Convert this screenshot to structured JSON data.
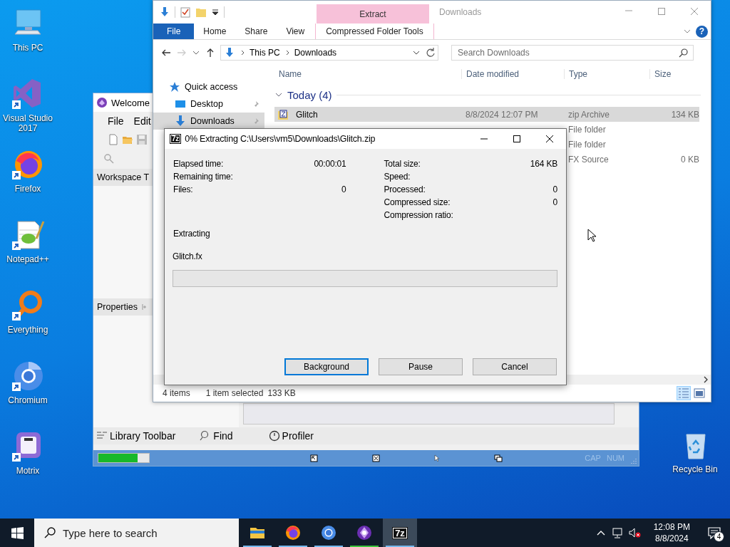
{
  "desktop": {
    "icons": [
      {
        "label": "This PC",
        "kind": "computer",
        "shortcut": false
      },
      {
        "label": "Visual Studio 2017",
        "kind": "visual-studio",
        "shortcut": true
      },
      {
        "label": "Firefox",
        "kind": "firefox",
        "shortcut": true
      },
      {
        "label": "Notepad++",
        "kind": "notepad",
        "shortcut": true
      },
      {
        "label": "Everything",
        "kind": "everything",
        "shortcut": true
      },
      {
        "label": "Chromium",
        "kind": "chromium",
        "shortcut": true
      },
      {
        "label": "Motrix",
        "kind": "motrix",
        "shortcut": true
      }
    ],
    "recycle_bin": {
      "label": "Recycle Bin"
    }
  },
  "background_window": {
    "title": "Welcome",
    "menu": [
      "File",
      "Edit"
    ],
    "workspace_panel": "Workspace T",
    "properties_panel": "Properties",
    "bottom_tabs": [
      {
        "label": "Library Toolbar",
        "kind": "library"
      },
      {
        "label": "Find",
        "kind": "find"
      },
      {
        "label": "Profiler",
        "kind": "profiler"
      }
    ],
    "status_bar": {
      "level": 0.77,
      "indicators": [
        {
          "label": "CAP",
          "on": false
        },
        {
          "label": "NUM",
          "on": false
        }
      ]
    }
  },
  "explorer": {
    "title": "Downloads",
    "context_tab": "Extract",
    "ribbon_tabs": [
      {
        "label": "File",
        "kind": "file"
      },
      {
        "label": "Home",
        "kind": "tab"
      },
      {
        "label": "Share",
        "kind": "tab"
      },
      {
        "label": "View",
        "kind": "tab"
      },
      {
        "label": "Compressed Folder Tools",
        "kind": "context"
      }
    ],
    "help": "?",
    "path": [
      "This PC",
      "Downloads"
    ],
    "search_placeholder": "Search Downloads",
    "nav": [
      {
        "label": "Quick access",
        "kind": "star",
        "pinned": false,
        "selected": false
      },
      {
        "label": "Desktop",
        "kind": "desktop",
        "pinned": true,
        "selected": false
      },
      {
        "label": "Downloads",
        "kind": "download",
        "pinned": true,
        "selected": true
      }
    ],
    "columns": [
      "Name",
      "Date modified",
      "Type",
      "Size"
    ],
    "group": "Today (4)",
    "rows": [
      {
        "name": "Glitch",
        "kind": "zip",
        "date": "8/8/2024 12:07 PM",
        "type": "zip Archive",
        "size": "134 KB",
        "selected": true
      },
      {
        "type": "File folder",
        "selected": false
      },
      {
        "type": "File folder",
        "selected": false
      },
      {
        "type": "FX Source",
        "size": "0 KB",
        "selected": false
      }
    ],
    "status": {
      "count": "4 items",
      "selection": "1 item selected",
      "selection_size": "133 KB"
    }
  },
  "dialog": {
    "badge": "7z",
    "title": "0% Extracting C:\\Users\\vm5\\Downloads\\Glitch.zip",
    "left_stats": [
      {
        "label": "Elapsed time:",
        "value": "00:00:01"
      },
      {
        "label": "Remaining time:"
      },
      {
        "label": "Files:",
        "value": "0"
      }
    ],
    "right_stats": [
      {
        "label": "Total size:",
        "value": "164 KB"
      },
      {
        "label": "Speed:"
      },
      {
        "label": "Processed:",
        "value": "0"
      },
      {
        "label": "Compressed size:",
        "value": "0"
      },
      {
        "label": "Compression ratio:"
      }
    ],
    "operation": "Extracting",
    "current_file": "Glitch.fx",
    "progress": {
      "level": 0
    },
    "buttons": [
      {
        "label": "Background",
        "focused": true
      },
      {
        "label": "Pause",
        "focused": false
      },
      {
        "label": "Cancel",
        "focused": false
      }
    ]
  },
  "taskbar": {
    "search_placeholder": "Type here to search",
    "apps": [
      {
        "kind": "folder",
        "color": "#76b9ed",
        "selected": false
      },
      {
        "kind": "firefox",
        "color": "#76b9ed",
        "selected": false
      },
      {
        "kind": "chromium",
        "color": "#76b9ed",
        "selected": false
      },
      {
        "kind": "purple",
        "color": "#3cc43c",
        "selected": false
      },
      {
        "kind": "sevenzip",
        "badge": "7z",
        "color": "#76b9ed",
        "selected": true
      }
    ],
    "time": "12:08 PM",
    "date": "8/8/2024",
    "notifications": "4"
  }
}
